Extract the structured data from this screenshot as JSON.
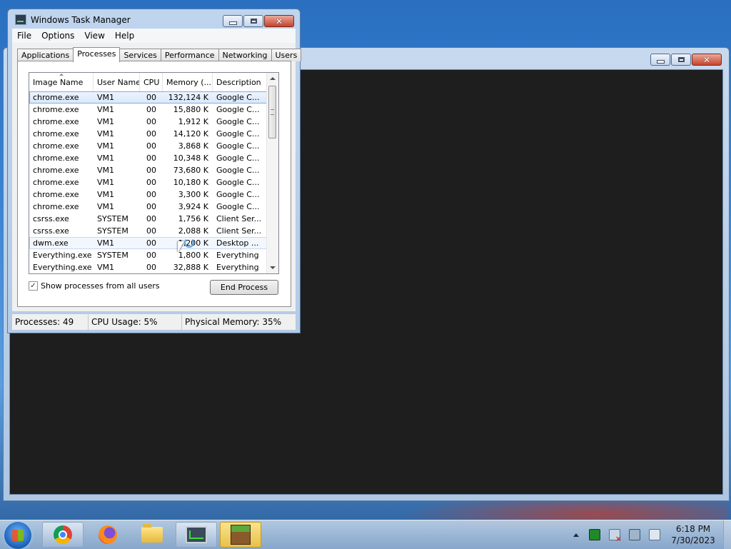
{
  "background_window": {
    "has_controls": true
  },
  "task_manager": {
    "title": "Windows Task Manager",
    "menu": [
      "File",
      "Options",
      "View",
      "Help"
    ],
    "tabs": [
      "Applications",
      "Processes",
      "Services",
      "Performance",
      "Networking",
      "Users"
    ],
    "active_tab": "Processes",
    "columns": [
      "Image Name",
      "User Name",
      "CPU",
      "Memory (...",
      "Description"
    ],
    "rows": [
      {
        "name": "chrome.exe",
        "user": "VM1",
        "cpu": "00",
        "mem": "132,124 K",
        "desc": "Google C..."
      },
      {
        "name": "chrome.exe",
        "user": "VM1",
        "cpu": "00",
        "mem": "15,880 K",
        "desc": "Google C..."
      },
      {
        "name": "chrome.exe",
        "user": "VM1",
        "cpu": "00",
        "mem": "1,912 K",
        "desc": "Google C..."
      },
      {
        "name": "chrome.exe",
        "user": "VM1",
        "cpu": "00",
        "mem": "14,120 K",
        "desc": "Google C..."
      },
      {
        "name": "chrome.exe",
        "user": "VM1",
        "cpu": "00",
        "mem": "3,868 K",
        "desc": "Google C..."
      },
      {
        "name": "chrome.exe",
        "user": "VM1",
        "cpu": "00",
        "mem": "10,348 K",
        "desc": "Google C..."
      },
      {
        "name": "chrome.exe",
        "user": "VM1",
        "cpu": "00",
        "mem": "73,680 K",
        "desc": "Google C..."
      },
      {
        "name": "chrome.exe",
        "user": "VM1",
        "cpu": "00",
        "mem": "10,180 K",
        "desc": "Google C..."
      },
      {
        "name": "chrome.exe",
        "user": "VM1",
        "cpu": "00",
        "mem": "3,300 K",
        "desc": "Google C..."
      },
      {
        "name": "chrome.exe",
        "user": "VM1",
        "cpu": "00",
        "mem": "3,924 K",
        "desc": "Google C..."
      },
      {
        "name": "csrss.exe",
        "user": "SYSTEM",
        "cpu": "00",
        "mem": "1,756 K",
        "desc": "Client Ser..."
      },
      {
        "name": "csrss.exe",
        "user": "SYSTEM",
        "cpu": "00",
        "mem": "2,088 K",
        "desc": "Client Ser..."
      },
      {
        "name": "dwm.exe",
        "user": "VM1",
        "cpu": "00",
        "mem": "1,200 K",
        "desc": "Desktop ..."
      },
      {
        "name": "Everything.exe",
        "user": "SYSTEM",
        "cpu": "00",
        "mem": "1,800 K",
        "desc": "Everything"
      },
      {
        "name": "Everything.exe",
        "user": "VM1",
        "cpu": "00",
        "mem": "32,888 K",
        "desc": "Everything"
      }
    ],
    "selected_row": 0,
    "hover_row": 12,
    "show_all_label": "Show processes from all users",
    "show_all_checked": true,
    "end_process_label": "End Process",
    "status": {
      "processes": "Processes: 49",
      "cpu": "CPU Usage: 5%",
      "memory": "Physical Memory: 35%"
    }
  },
  "taskbar": {
    "pinned": [
      {
        "icon": "chrome-icon",
        "running": true
      },
      {
        "icon": "firefox-icon",
        "running": false
      },
      {
        "icon": "folder-icon",
        "running": false
      },
      {
        "icon": "task-manager-icon",
        "running": true
      },
      {
        "icon": "minecraft-icon",
        "running": true,
        "active": true
      }
    ],
    "tray_icons": [
      "show-hidden-icons",
      "green-app-icon",
      "action-center-flag-icon",
      "network-icon",
      "volume-muted-icon"
    ],
    "time": "6:18 PM",
    "date": "7/30/2023"
  }
}
